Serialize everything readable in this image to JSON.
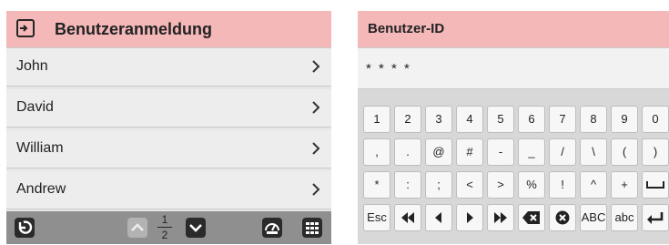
{
  "login": {
    "title": "Benutzeranmeldung",
    "users": [
      "John",
      "David",
      "William",
      "Andrew"
    ],
    "page_current": "1",
    "page_total": "2"
  },
  "keypad": {
    "title": "Benutzer-ID",
    "value": "* * * *",
    "row1": [
      "1",
      "2",
      "3",
      "4",
      "5",
      "6",
      "7",
      "8",
      "9",
      "0"
    ],
    "row2": [
      ",",
      ".",
      "@",
      "#",
      "-",
      "_",
      "/",
      "\\",
      "(",
      ")"
    ],
    "row3": [
      "*",
      ":",
      ";",
      "<",
      ">",
      "%",
      "!",
      "^",
      "+",
      "space"
    ],
    "row4": [
      "Esc",
      "rewind",
      "left",
      "right",
      "fast-forward",
      "backspace",
      "clear",
      "ABC",
      "abc",
      "enter"
    ]
  },
  "colors": {
    "header": "#f5b8b9",
    "footer": "#8f8f8f",
    "button": "#2a2a2a"
  },
  "icons": [
    "login-icon",
    "chevron-right-icon",
    "back-icon",
    "page-up-icon",
    "page-down-icon",
    "dashboard-icon",
    "grid-icon"
  ]
}
